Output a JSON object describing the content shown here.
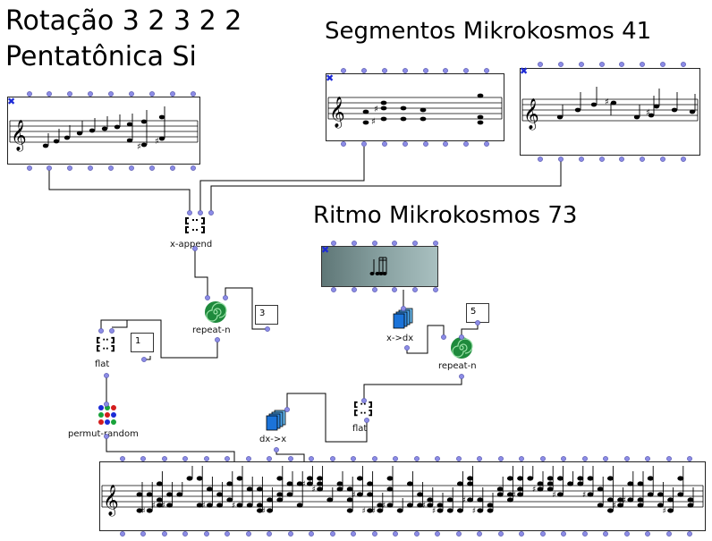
{
  "titles": {
    "rotation": "Rotação 3 2 3 2 2",
    "pentatonic": "Pentatônica Si",
    "segments": "Segmentos Mikrokosmos 41",
    "rhythm": "Ritmo Mikrokosmos 73"
  },
  "nodes": {
    "x_append": "x-append",
    "repeat_n_1": "repeat-n",
    "flat_1": "flat",
    "permut_random": "permut-random",
    "x_dx": "x->dx",
    "repeat_n_2": "repeat-n",
    "dx_x": "dx->x",
    "flat_2": "flat"
  },
  "values": {
    "repeat_count_1": "3",
    "flat_level_1": "1",
    "repeat_count_2": "5"
  },
  "colors": {
    "inlet": "#8c8ce6",
    "close_x": "#1d2ad6",
    "wire": "#000000",
    "rhythm_box": "#7e9999"
  },
  "icons": {
    "close": "close-x-icon",
    "append": "brackets-icon",
    "repeat": "spiral-icon",
    "flat": "brackets-icon",
    "permut": "colored-dots-icon",
    "dx": "stacked-pages-icon",
    "rhythm": "notes-icon"
  }
}
